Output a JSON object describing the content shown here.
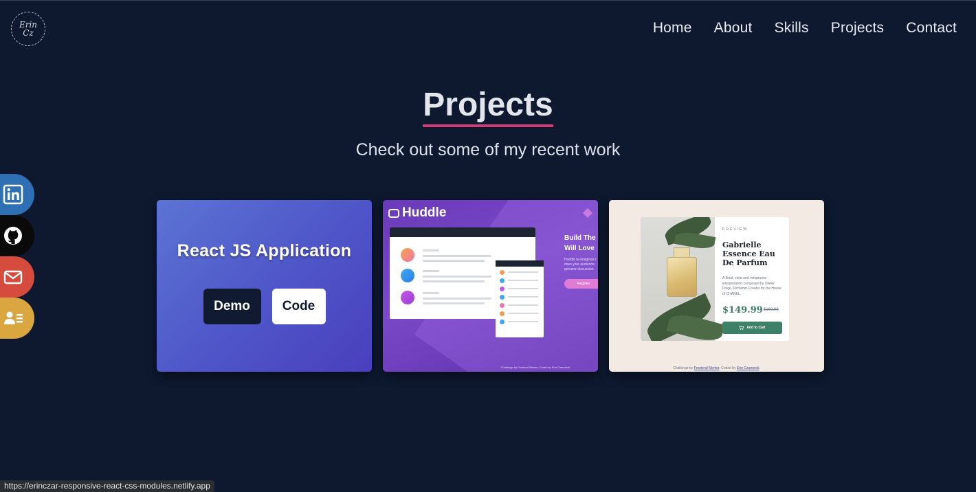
{
  "logo": {
    "line1": "Erin",
    "line2": "Cz"
  },
  "nav": [
    "Home",
    "About",
    "Skills",
    "Projects",
    "Contact"
  ],
  "hero": {
    "title": "Projects",
    "subtitle": "Check out some of my recent work"
  },
  "social": [
    {
      "name": "linkedin-icon",
      "color": "#2f6fb4"
    },
    {
      "name": "github-icon",
      "color": "#0a0a0a"
    },
    {
      "name": "email-icon",
      "color": "#d54b3d"
    },
    {
      "name": "contact-card-icon",
      "color": "#d9a640"
    }
  ],
  "cards": {
    "react": {
      "title": "React JS Application",
      "demo": "Demo",
      "code": "Code"
    },
    "huddle": {
      "brand": "Huddle",
      "heading1": "Build The",
      "heading2": "Will Love",
      "text": "Huddle re-imagines t does your audience. genuine discussion.",
      "register": "Register",
      "footer": "Challenge by Frontend Mentor. Coded by Erin Czarnecki."
    },
    "perfume": {
      "preview": "PREVIEW",
      "name": "Gabrielle Essence Eau De Parfum",
      "description": "A floral, solar and voluptuous interpretation composed by Olivier Polge, Perfumer-Creator for the House of CHANEL.",
      "price": "$149.99",
      "old_price": "$169.99",
      "cart": "Add to Cart",
      "footer_prefix": "Challenge by",
      "footer_link1": "Frontend Mentor",
      "footer_mid": ". Coded by",
      "footer_link2": "Erin Czarnecki",
      "footer_end": "."
    }
  },
  "status_url": "https://erinczar-responsive-react-css-modules.netlify.app"
}
